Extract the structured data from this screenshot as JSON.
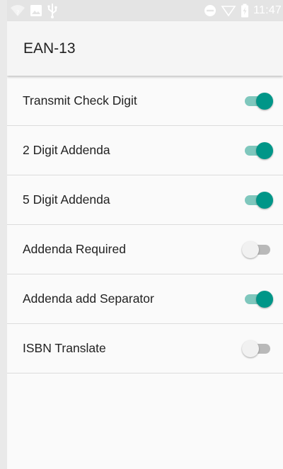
{
  "status_bar": {
    "time": "11:47",
    "icons_left": [
      "wifi-question-icon",
      "image-icon",
      "usb-icon"
    ],
    "icons_right": [
      "do-not-disturb-icon",
      "signal-icon",
      "battery-charging-icon"
    ]
  },
  "app_bar": {
    "title": "EAN-13"
  },
  "settings": [
    {
      "label": "Transmit Check Digit",
      "enabled": true
    },
    {
      "label": "2 Digit Addenda",
      "enabled": true
    },
    {
      "label": "5 Digit Addenda",
      "enabled": true
    },
    {
      "label": "Addenda Required",
      "enabled": false
    },
    {
      "label": "Addenda add Separator",
      "enabled": true
    },
    {
      "label": "ISBN Translate",
      "enabled": false
    }
  ],
  "colors": {
    "accent": "#009688",
    "accent_track": "#7fc7bd",
    "off_thumb": "#f1f1f1",
    "off_track": "#b9b9b9"
  }
}
